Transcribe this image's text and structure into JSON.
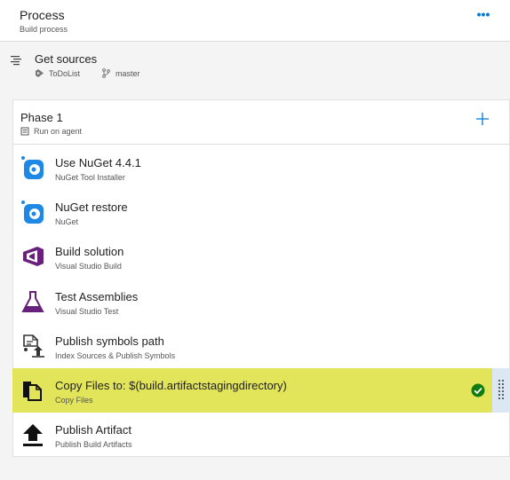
{
  "process": {
    "title": "Process",
    "subtitle": "Build process",
    "more_label": "•••"
  },
  "sources": {
    "title": "Get sources",
    "repo": "ToDoList",
    "branch": "master"
  },
  "phase": {
    "title": "Phase 1",
    "subtitle": "Run on agent"
  },
  "tasks": [
    {
      "name": "Use NuGet 4.4.1",
      "kind": "NuGet Tool Installer",
      "icon": "nuget-icon"
    },
    {
      "name": "NuGet restore",
      "kind": "NuGet",
      "icon": "nuget-icon"
    },
    {
      "name": "Build solution",
      "kind": "Visual Studio Build",
      "icon": "visual-studio-icon"
    },
    {
      "name": "Test Assemblies",
      "kind": "Visual Studio Test",
      "icon": "flask-icon"
    },
    {
      "name": "Publish symbols path",
      "kind": "Index Sources & Publish Symbols",
      "icon": "publish-symbols-icon"
    },
    {
      "name": "Copy Files to: $(build.artifactstagingdirectory)",
      "kind": "Copy Files",
      "icon": "copy-files-icon",
      "selected": true,
      "status": "enabled"
    },
    {
      "name": "Publish Artifact",
      "kind": "Publish Build Artifacts",
      "icon": "upload-icon"
    }
  ],
  "colors": {
    "accent": "#0078d4",
    "highlight": "#e2e55a",
    "nuget": "#1e88e5",
    "visual_studio": "#68217a",
    "check": "#107c10"
  }
}
